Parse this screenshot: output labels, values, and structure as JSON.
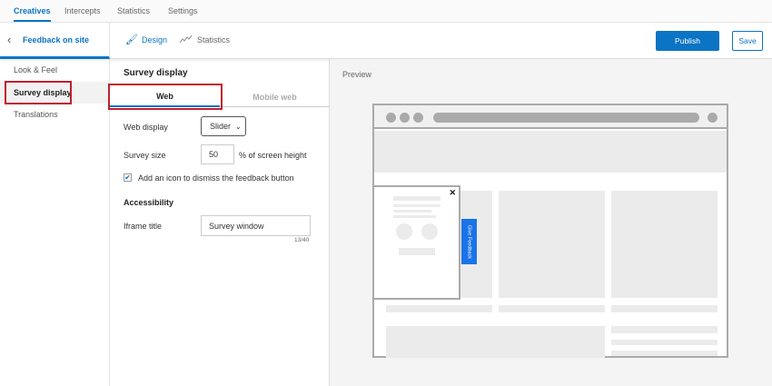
{
  "topnav": {
    "tabs": [
      "Creatives",
      "Intercepts",
      "Statistics",
      "Settings"
    ]
  },
  "header": {
    "back_label": "Feedback on site",
    "design": "Design",
    "statistics": "Statistics",
    "publish": "Publish",
    "save": "Save"
  },
  "sidebar": {
    "items": [
      "Look & Feel",
      "Survey display",
      "Translations"
    ]
  },
  "panel": {
    "title": "Survey display",
    "tabs": [
      "Web",
      "Mobile web"
    ],
    "web_display_label": "Web display",
    "web_display_value": "Slider",
    "survey_size_label": "Survey size",
    "survey_size_value": "50",
    "survey_size_unit": "% of screen height",
    "dismiss_checkbox_label": "Add an icon to dismiss the feedback button",
    "dismiss_checked": true,
    "accessibility_heading": "Accessibility",
    "iframe_label": "Iframe title",
    "iframe_value": "Survey window",
    "char_count": "13/40"
  },
  "preview": {
    "label": "Preview",
    "feedback_button": "Give Feedback",
    "close": "✕"
  },
  "colors": {
    "accent": "#0b74c4",
    "highlight": "#c0202e",
    "feedback": "#1a73e8"
  }
}
